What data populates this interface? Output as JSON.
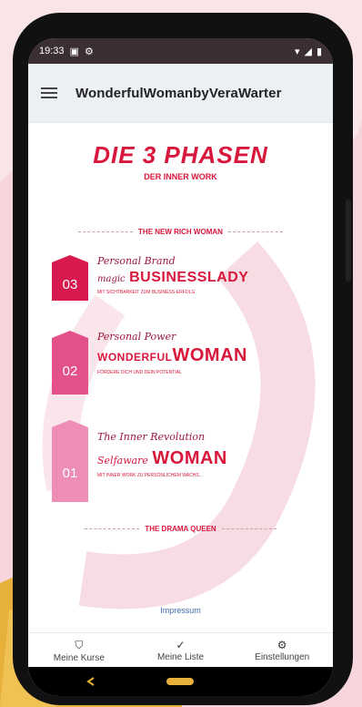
{
  "status_bar": {
    "time": "19:33",
    "left_icons": [
      "notification-icon",
      "settings-icon"
    ],
    "right_icons": [
      "wifi-icon",
      "signal-icon",
      "battery-icon"
    ]
  },
  "app_bar": {
    "title": "WonderfulWomanbyVeraWarter",
    "menu_icon": "hamburger-menu-icon"
  },
  "content": {
    "title": "DIE 3 PHASEN",
    "subtitle": "DER INNER WORK",
    "top_divider": "THE NEW RICH WOMAN",
    "phases": [
      {
        "number": "03",
        "script": "Personal Brand",
        "brand_prefix": "magic",
        "brand_main": "BUSINESSLADY",
        "description": "MIT SICHTBARKEIT ZUM BUSINESS-ERFOLG",
        "color": "#d8194d"
      },
      {
        "number": "02",
        "script": "Personal Power",
        "brand_prefix": "WONDERFUL",
        "brand_main": "WOMAN",
        "description": "FÖRDERE DICH UND DEIN POTENTIAL",
        "color": "#e4508a"
      },
      {
        "number": "01",
        "script": "The Inner Revolution",
        "brand_prefix": "Selfaware",
        "brand_main": "WOMAN",
        "description": "MIT INNER WORK ZU PERSÖNLICHEM WACHS..",
        "color": "#ee8db6"
      }
    ],
    "bottom_divider": "THE DRAMA QUEEN",
    "footer_link": "Impressum"
  },
  "bottom_nav": [
    {
      "label": "Meine Kurse",
      "icon": "courses-icon"
    },
    {
      "label": "Meine Liste",
      "icon": "check-icon"
    },
    {
      "label": "Einstellungen",
      "icon": "gear-icon"
    }
  ]
}
